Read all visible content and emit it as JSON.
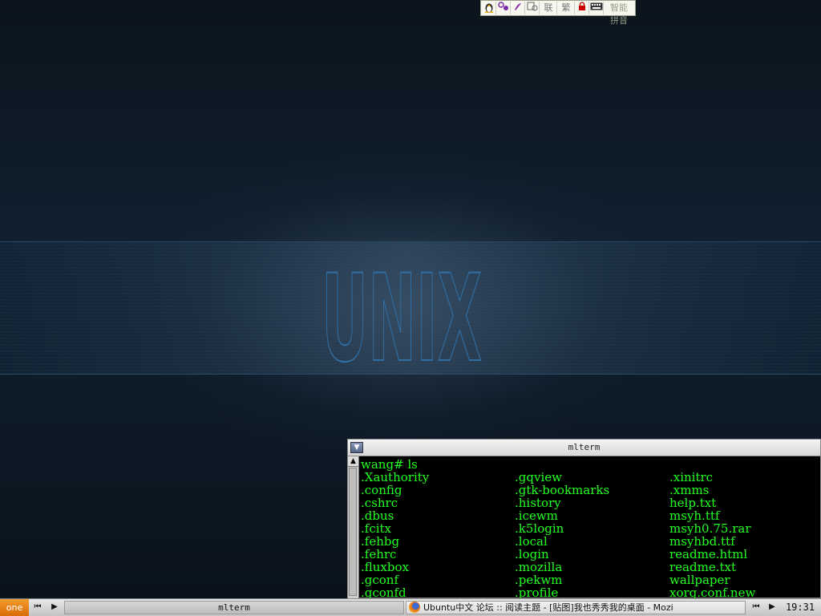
{
  "wallpaper": {
    "logo_text": "UNIX"
  },
  "tray": {
    "items": [
      "penguin-icon",
      "fullwidth-icon",
      "punctuation-icon",
      "soft-keyboard-icon"
    ],
    "lian_label": "联",
    "fan_label": "繁",
    "ime_label": "智能拼音"
  },
  "terminal": {
    "title": "mlterm",
    "prompt": "wang# ls",
    "columns": [
      [
        ".Xauthority",
        ".config",
        ".cshrc",
        ".dbus",
        ".fcitx",
        ".fehbg",
        ".fehrc",
        ".fluxbox",
        ".gconf",
        ".gconfd"
      ],
      [
        ".gqview",
        ".gtk-bookmarks",
        ".history",
        ".icewm",
        ".k5login",
        ".local",
        ".login",
        ".mozilla",
        ".pekwm",
        ".profile"
      ],
      [
        ".xinitrc",
        ".xmms",
        "help.txt",
        "msyh.ttf",
        "msyh0.75.rar",
        "msyhbd.ttf",
        "readme.html",
        "readme.txt",
        "wallpaper",
        "xorg.conf.new"
      ]
    ]
  },
  "taskbar": {
    "workspace_label": "one",
    "task_mlterm": "mlterm",
    "task_firefox": "Ubuntu中文 论坛 :: 阅读主题 - [贴图]我也秀秀我的桌面 - Mozi",
    "clock": "19:31"
  },
  "colors": {
    "terminal_text": "#22ff22",
    "workspace_accent": "#e8800f"
  }
}
